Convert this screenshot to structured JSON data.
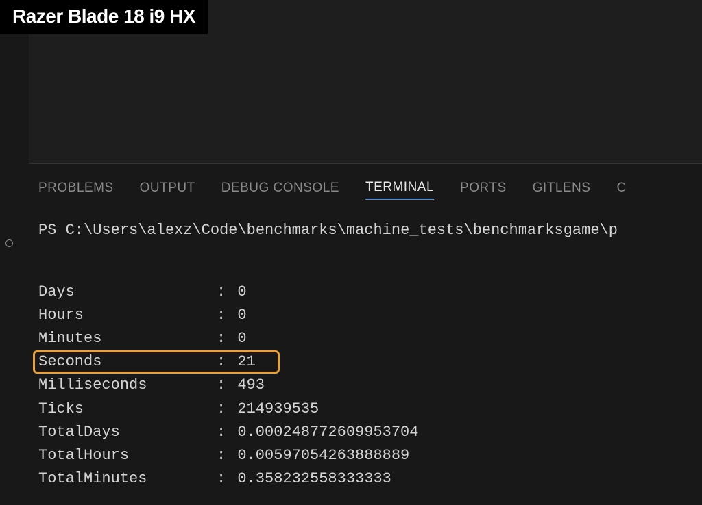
{
  "overlay": {
    "title": "Razer Blade 18 i9 HX"
  },
  "tabs": {
    "problems": "PROBLEMS",
    "output": "OUTPUT",
    "debug_console": "DEBUG CONSOLE",
    "terminal": "TERMINAL",
    "ports": "PORTS",
    "gitlens": "GITLENS",
    "more": "C"
  },
  "terminal": {
    "prompt": "PS C:\\Users\\alexz\\Code\\benchmarks\\machine_tests\\benchmarksgame\\p",
    "rows": [
      {
        "key": "Days",
        "value": "0"
      },
      {
        "key": "Hours",
        "value": "0"
      },
      {
        "key": "Minutes",
        "value": "0"
      },
      {
        "key": "Seconds",
        "value": "21",
        "highlight": true
      },
      {
        "key": "Milliseconds",
        "value": "493"
      },
      {
        "key": "Ticks",
        "value": "214939535"
      },
      {
        "key": "TotalDays",
        "value": "0.000248772609953704"
      },
      {
        "key": "TotalHours",
        "value": "0.00597054263888889"
      },
      {
        "key": "TotalMinutes",
        "value": "0.358232558333333"
      }
    ],
    "separator": ":"
  }
}
